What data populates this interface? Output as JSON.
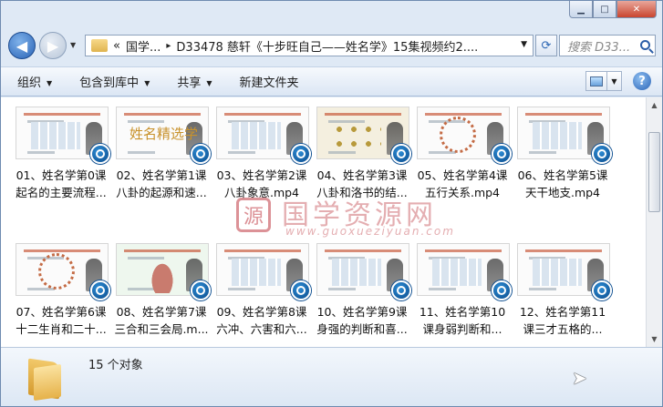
{
  "window": {
    "minimize_glyph": "▁",
    "maximize_glyph": "□",
    "close_glyph": "✕"
  },
  "nav": {
    "back_glyph": "◀",
    "forward_glyph": "▶",
    "address": {
      "chevron": "«",
      "segment1": "国学...",
      "separator": "▸",
      "segment2": "D33478 慈轩《十步旺自己——姓名学》15集视频约2...."
    },
    "refresh_glyph": "⟳",
    "search_placeholder": "搜索 D33..."
  },
  "toolbar": {
    "organize": "组织",
    "include_in_library": "包含到库中",
    "share": "共享",
    "new_folder": "新建文件夹",
    "help_glyph": "?"
  },
  "files": [
    {
      "line1": "01、姓名学第0课",
      "line2": "起名的主要流程...",
      "thumb": "list"
    },
    {
      "line1": "02、姓名学第1课",
      "line2": "八卦的起源和速...",
      "thumb": "title",
      "thumb_text": "姓名精选学"
    },
    {
      "line1": "03、姓名学第2课",
      "line2": "八卦象意.mp4",
      "thumb": "grid"
    },
    {
      "line1": "04、姓名学第3课",
      "line2": "八卦和洛书的结...",
      "thumb": "gold"
    },
    {
      "line1": "05、姓名学第4课",
      "line2": "五行关系.mp4",
      "thumb": "wheel"
    },
    {
      "line1": "06、姓名学第5课",
      "line2": "天干地支.mp4",
      "thumb": "doc"
    },
    {
      "line1": "07、姓名学第6课",
      "line2": "十二生肖和二十...",
      "thumb": "wheel"
    },
    {
      "line1": "08、姓名学第7课",
      "line2": "三合和三会局.m...",
      "thumb": "hand"
    },
    {
      "line1": "09、姓名学第8课",
      "line2": "六冲、六害和六...",
      "thumb": "grid"
    },
    {
      "line1": "10、姓名学第9课",
      "line2": "身强的判断和喜...",
      "thumb": "list"
    },
    {
      "line1": "11、姓名学第10",
      "line2": "课身弱判断和...",
      "thumb": "list"
    },
    {
      "line1": "12、姓名学第11",
      "line2": "课三才五格的...",
      "thumb": "grid"
    }
  ],
  "watermark": {
    "logo": "源",
    "text": "国学资源网",
    "url": "www.guoxueziyuan.com"
  },
  "status": {
    "count_text": "15 个对象"
  }
}
